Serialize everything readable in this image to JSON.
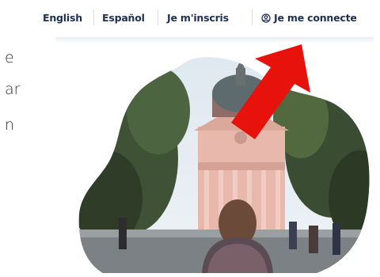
{
  "nav": {
    "items": [
      {
        "label": "English"
      },
      {
        "label": "Español"
      },
      {
        "label": "Je m'inscris"
      },
      {
        "label": "Je me connecte",
        "icon": "user-circle-icon"
      }
    ]
  },
  "side_text": [
    "e",
    "ar",
    "n"
  ],
  "hero": {
    "image": "sorbonne-building-photo"
  },
  "annotation": {
    "icon": "red-arrow-icon",
    "color": "#e8120c"
  },
  "colors": {
    "nav_text": "#1f2f52"
  }
}
